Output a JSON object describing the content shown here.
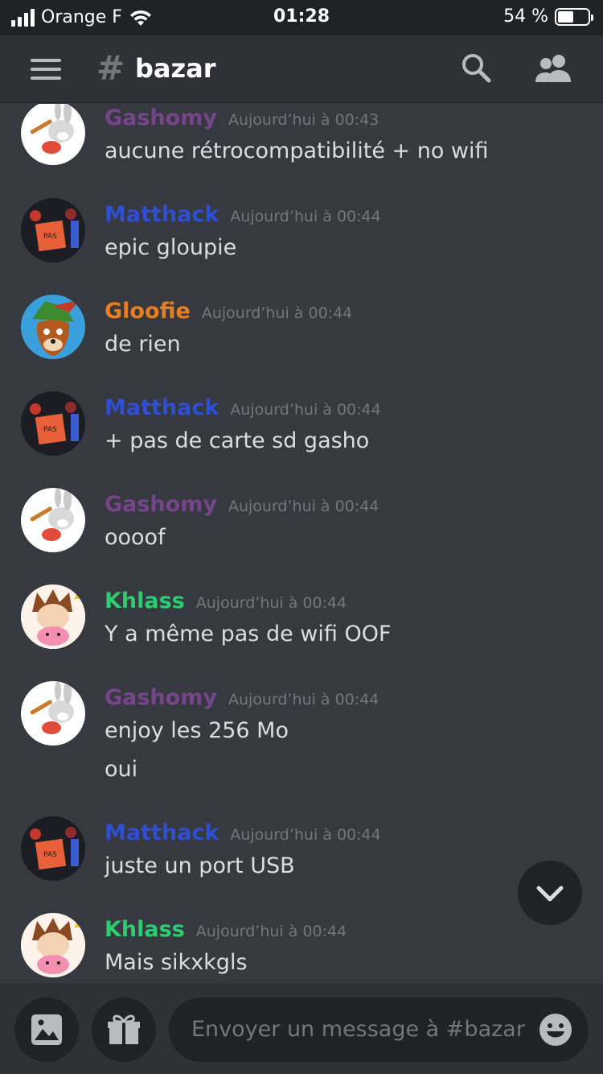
{
  "status_bar": {
    "carrier": "Orange F",
    "time": "01:28",
    "battery_label": "54 %",
    "battery_level": 0.54
  },
  "header": {
    "hash": "#",
    "channel": "bazar",
    "icons": [
      "menu-icon",
      "search-icon",
      "members-icon"
    ]
  },
  "colors": {
    "gashomy": "#76448a",
    "matthack": "#2e4fd1",
    "gloofie": "#e67e22",
    "khlass": "#2ecc71",
    "background": "#36393f",
    "header": "#2f3136"
  },
  "messages": [
    {
      "author": "Gashomy",
      "time": "Aujourd’hui à 00:43",
      "lines": [
        "aucune rétrocompatibilité + no wifi"
      ]
    },
    {
      "author": "Matthack",
      "time": "Aujourd’hui à 00:44",
      "lines": [
        "epic gloupie"
      ]
    },
    {
      "author": "Gloofie",
      "time": "Aujourd’hui à 00:44",
      "lines": [
        "de rien"
      ]
    },
    {
      "author": "Matthack",
      "time": "Aujourd’hui à 00:44",
      "lines": [
        "+ pas de carte sd gasho"
      ]
    },
    {
      "author": "Gashomy",
      "time": "Aujourd’hui à 00:44",
      "lines": [
        "oooof"
      ]
    },
    {
      "author": "Khlass",
      "time": "Aujourd’hui à 00:44",
      "lines": [
        "Y a même pas de wifi OOF"
      ]
    },
    {
      "author": "Gashomy",
      "time": "Aujourd’hui à 00:44",
      "lines": [
        "enjoy les 256 Mo",
        "oui"
      ]
    },
    {
      "author": "Matthack",
      "time": "Aujourd’hui à 00:44",
      "lines": [
        "juste un port USB"
      ]
    },
    {
      "author": "Khlass",
      "time": "Aujourd’hui à 00:44",
      "lines": [
        "Mais sikxkgls"
      ]
    }
  ],
  "composer": {
    "placeholder": "Envoyer un message à #bazar",
    "icons": [
      "image-icon",
      "gift-icon",
      "emoji-icon"
    ]
  }
}
